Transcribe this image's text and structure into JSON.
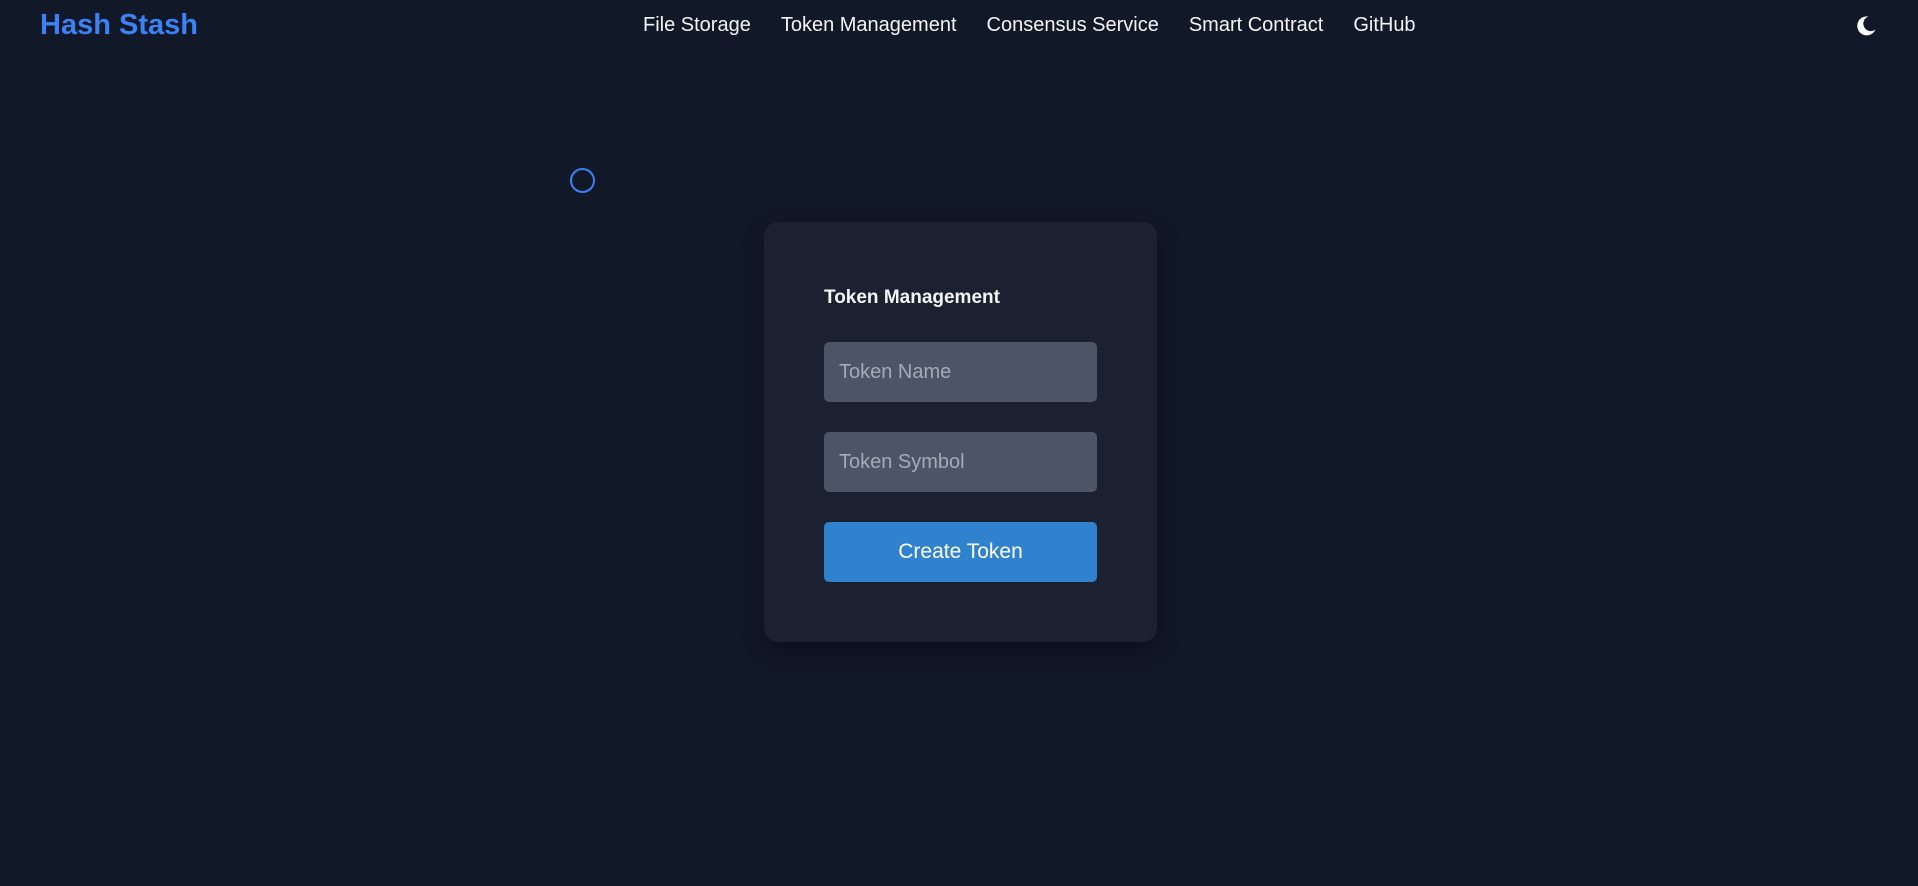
{
  "header": {
    "brand": "Hash Stash",
    "nav": [
      {
        "label": "File Storage"
      },
      {
        "label": "Token Management"
      },
      {
        "label": "Consensus Service"
      },
      {
        "label": "Smart Contract"
      },
      {
        "label": "GitHub"
      }
    ],
    "theme_toggle_icon": "moon-icon"
  },
  "form": {
    "title": "Token Management",
    "token_name": {
      "value": "",
      "placeholder": "Token Name"
    },
    "token_symbol": {
      "value": "",
      "placeholder": "Token Symbol"
    },
    "submit_label": "Create Token"
  },
  "colors": {
    "background": "#111827",
    "card": "#1b2130",
    "accent": "#3b82f6",
    "button": "#3182ce",
    "input": "#4b5565"
  }
}
